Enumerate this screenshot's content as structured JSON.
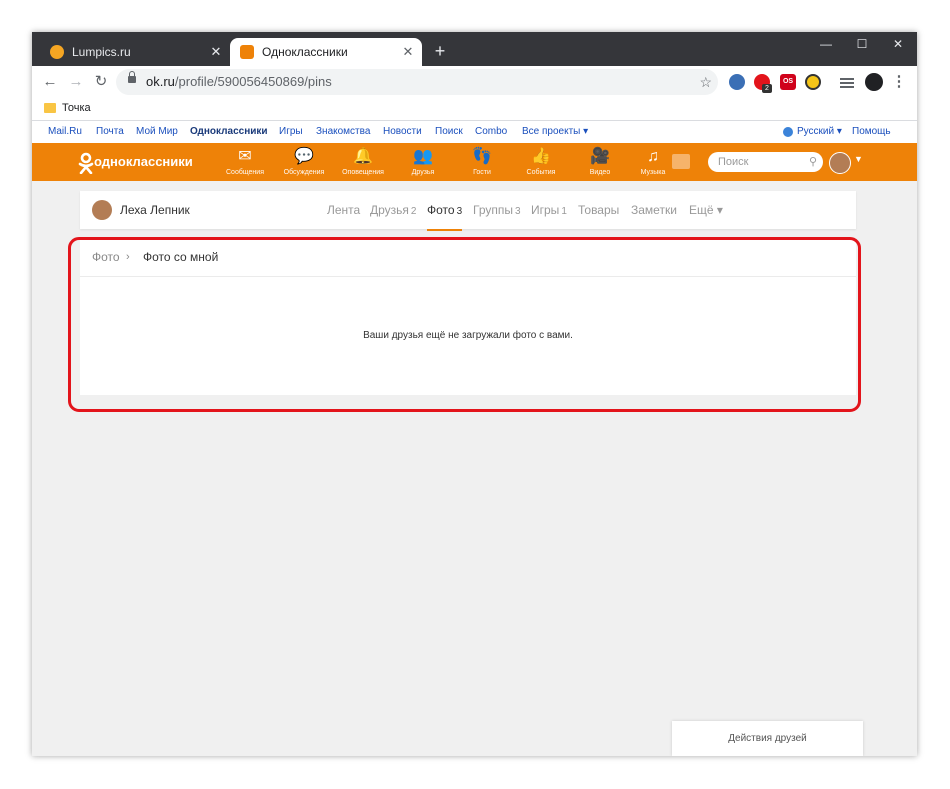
{
  "browser": {
    "tabs": [
      {
        "title": "Lumpics.ru",
        "close": "✕"
      },
      {
        "title": "Одноклассники",
        "close": "✕"
      }
    ],
    "new_tab": "+",
    "window_controls": {
      "minimize": "—",
      "maximize": "☐",
      "close": "✕"
    },
    "nav": {
      "back": "←",
      "forward": "→",
      "reload": "↻"
    },
    "address": {
      "domain": "ok.ru",
      "path": "/profile/590056450869/pins"
    },
    "bookmark_star": "☆",
    "extensions": {
      "badge": "2",
      "os_label": "OS",
      "menu": "⋮"
    },
    "bookmarks": [
      {
        "label": "Точка"
      }
    ]
  },
  "portal_links": [
    "Mail.Ru",
    "Почта",
    "Мой Мир",
    "Одноклассники",
    "Игры",
    "Знакомства",
    "Новости",
    "Поиск",
    "Combo",
    "Все проекты ▾"
  ],
  "portal_right": {
    "language": "Русский ▾",
    "help": "Помощь"
  },
  "ok_header": {
    "logo_text": "одноклассники",
    "nav": [
      {
        "icon": "envelope-icon",
        "glyph": "✉",
        "label": "Сообщения"
      },
      {
        "icon": "chat-icon",
        "glyph": "💬",
        "label": "Обсуждения"
      },
      {
        "icon": "bell-icon",
        "glyph": "🔔",
        "label": "Оповещения"
      },
      {
        "icon": "friends-icon",
        "glyph": "👥",
        "label": "Друзья"
      },
      {
        "icon": "footprints-icon",
        "glyph": "👣",
        "label": "Гости"
      },
      {
        "icon": "events-icon",
        "glyph": "👍",
        "label": "События"
      },
      {
        "icon": "video-icon",
        "glyph": "🎥",
        "label": "Видео"
      },
      {
        "icon": "music-icon",
        "glyph": "♫",
        "label": "Музыка"
      }
    ],
    "search_placeholder": "Поиск",
    "accent_color": "#ee8208"
  },
  "profile": {
    "name": "Леха Лепник",
    "tabs": [
      {
        "label": "Лента",
        "count": ""
      },
      {
        "label": "Друзья",
        "count": "2"
      },
      {
        "label": "Фото",
        "count": "3"
      },
      {
        "label": "Группы",
        "count": "3"
      },
      {
        "label": "Игры",
        "count": "1"
      },
      {
        "label": "Товары",
        "count": ""
      },
      {
        "label": "Заметки",
        "count": ""
      },
      {
        "label": "Ещё ▾",
        "count": ""
      }
    ],
    "active_tab": "Фото"
  },
  "breadcrumb": {
    "parent": "Фото",
    "separator": "›",
    "current": "Фото со мной"
  },
  "empty_message": "Ваши друзья ещё не загружали фото с вами.",
  "friends_activity": "Действия друзей",
  "highlight_color": "#e3141b"
}
